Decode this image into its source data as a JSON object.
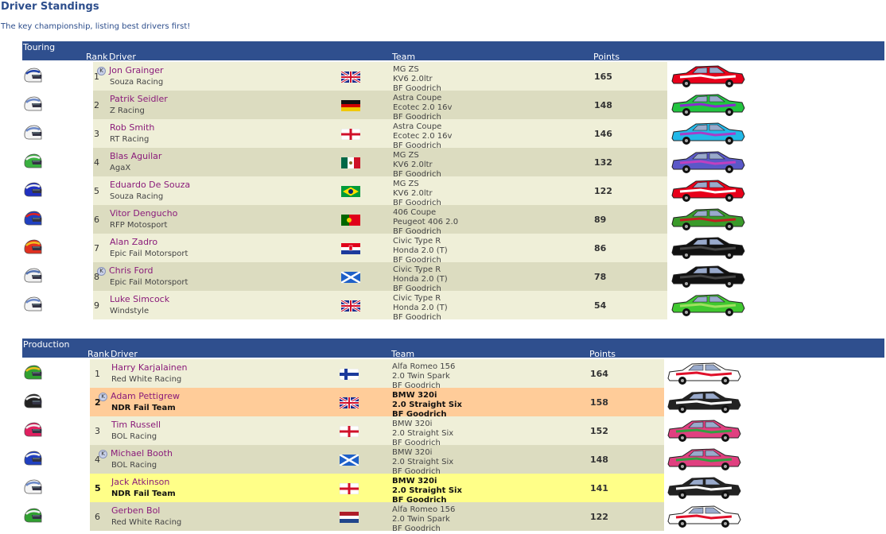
{
  "page": {
    "title": "Driver Standings",
    "subtitle": "The key championship, listing best drivers first!"
  },
  "columns": {
    "rank": "Rank",
    "driver": "Driver",
    "team": "Team",
    "points": "Points"
  },
  "colors": {
    "header": "#2f4f8e",
    "row_light": "#efefd8",
    "row_dark": "#dcdcc0",
    "row_orange": "#ffcc99",
    "row_yellow": "#ffff88",
    "driver_name": "#8a1b7a"
  },
  "sections": [
    {
      "name": "Touring",
      "rows": [
        {
          "rank": "1",
          "k": true,
          "driver": "Jon Grainger",
          "team": "Souza Racing",
          "flag": "gb",
          "car": [
            "MG ZS",
            "KV6 2.0ltr",
            "BF Goodrich"
          ],
          "points": "165",
          "helmet": [
            "#f0f0f0",
            "#1c3fa8"
          ],
          "livery": [
            "#e8001a",
            "#ffffff"
          ],
          "style": "light"
        },
        {
          "rank": "2",
          "k": false,
          "driver": "Patrik Seidler",
          "team": "Z Racing",
          "flag": "de",
          "car": [
            "Astra Coupe",
            "Ecotec 2.0 16v",
            "BF Goodrich"
          ],
          "points": "148",
          "helmet": [
            "#f4f4f4",
            "#6b88c8"
          ],
          "livery": [
            "#22c440",
            "#8a2bd0"
          ],
          "style": "dark"
        },
        {
          "rank": "3",
          "k": false,
          "driver": "Rob Smith",
          "team": "RT Racing",
          "flag": "en",
          "car": [
            "Astra Coupe",
            "Ecotec 2.0 16v",
            "BF Goodrich"
          ],
          "points": "146",
          "helmet": [
            "#f4f4f4",
            "#6b88c8"
          ],
          "livery": [
            "#22b8e8",
            "#a83cc8"
          ],
          "style": "light"
        },
        {
          "rank": "4",
          "k": false,
          "driver": "Blas Aguilar",
          "team": "AgaX",
          "flag": "mx",
          "car": [
            "MG ZS",
            "KV6 2.0ltr",
            "BF Goodrich"
          ],
          "points": "132",
          "helmet": [
            "#3ab040",
            "#f0f0f0"
          ],
          "livery": [
            "#5a58c8",
            "#c040c0"
          ],
          "style": "dark"
        },
        {
          "rank": "5",
          "k": false,
          "driver": "Eduardo De Souza",
          "team": "Souza Racing",
          "flag": "br",
          "car": [
            "MG ZS",
            "KV6 2.0ltr",
            "BF Goodrich"
          ],
          "points": "122",
          "helmet": [
            "#2030c0",
            "#f0f0f0"
          ],
          "livery": [
            "#e8001a",
            "#ffffff"
          ],
          "style": "light"
        },
        {
          "rank": "6",
          "k": false,
          "driver": "Vitor Dengucho",
          "team": "RFP Motosport",
          "flag": "pt",
          "car": [
            "406 Coupe",
            "Peugeot 406 2.0",
            "BF Goodrich"
          ],
          "points": "89",
          "helmet": [
            "#2040c0",
            "#e02020"
          ],
          "livery": [
            "#3a9a2a",
            "#c02020"
          ],
          "style": "dark"
        },
        {
          "rank": "7",
          "k": false,
          "driver": "Alan Zadro",
          "team": "Epic Fail Motorsport",
          "flag": "hr",
          "car": [
            "Civic Type R",
            "Honda 2.0 (T)",
            "BF Goodrich"
          ],
          "points": "86",
          "helmet": [
            "#e03020",
            "#f0c020"
          ],
          "livery": [
            "#111111",
            "#444444"
          ],
          "style": "light"
        },
        {
          "rank": "8",
          "k": true,
          "driver": "Chris Ford",
          "team": "Epic Fail Motorsport",
          "flag": "sc",
          "car": [
            "Civic Type R",
            "Honda 2.0 (T)",
            "BF Goodrich"
          ],
          "points": "78",
          "helmet": [
            "#f0f0f0",
            "#5070b0"
          ],
          "livery": [
            "#111111",
            "#444444"
          ],
          "style": "dark"
        },
        {
          "rank": "9",
          "k": false,
          "driver": "Luke Simcock",
          "team": "Windstyle",
          "flag": "gb",
          "car": [
            "Civic Type R",
            "Honda 2.0 (T)",
            "BF Goodrich"
          ],
          "points": "54",
          "helmet": [
            "#f4f4f4",
            "#6b88c8"
          ],
          "livery": [
            "#40c830",
            "#a0e060"
          ],
          "style": "light"
        }
      ]
    },
    {
      "name": "Production",
      "rows": [
        {
          "rank": "1",
          "k": false,
          "driver": "Harry Karjalainen",
          "team": "Red White Racing",
          "flag": "fi",
          "car": [
            "Alfa Romeo 156",
            "2.0 Twin Spark",
            "BF Goodrich"
          ],
          "points": "164",
          "helmet": [
            "#30a030",
            "#f0c020"
          ],
          "livery": [
            "#ffffff",
            "#e0102a"
          ],
          "style": "light"
        },
        {
          "rank": "2",
          "k": true,
          "driver": "Adam Pettigrew",
          "team": "NDR Fail Team",
          "flag": "gb",
          "car": [
            "BMW 320i",
            "2.0 Straight Six",
            "BF Goodrich"
          ],
          "points": "158",
          "helmet": [
            "#222222",
            "#f0f0f0"
          ],
          "livery": [
            "#222222",
            "#ffffff"
          ],
          "style": "orange"
        },
        {
          "rank": "3",
          "k": false,
          "driver": "Tim Russell",
          "team": "BOL Racing",
          "flag": "en",
          "car": [
            "BMW 320i",
            "2.0 Straight Six",
            "BF Goodrich"
          ],
          "points": "152",
          "helmet": [
            "#e02060",
            "#f0f0f0"
          ],
          "livery": [
            "#e04080",
            "#30a040"
          ],
          "style": "light"
        },
        {
          "rank": "4",
          "k": true,
          "driver": "Michael Booth",
          "team": "BOL Racing",
          "flag": "sc",
          "car": [
            "BMW 320i",
            "2.0 Straight Six",
            "BF Goodrich"
          ],
          "points": "148",
          "helmet": [
            "#2040c0",
            "#f0f0f0"
          ],
          "livery": [
            "#e04080",
            "#30a040"
          ],
          "style": "dark"
        },
        {
          "rank": "5",
          "k": false,
          "driver": "Jack Atkinson",
          "team": "NDR Fail Team",
          "flag": "en",
          "car": [
            "BMW 320i",
            "2.0 Straight Six",
            "BF Goodrich"
          ],
          "points": "141",
          "helmet": [
            "#f4f4f4",
            "#6b88c8"
          ],
          "livery": [
            "#222222",
            "#ffffff"
          ],
          "style": "yellow"
        },
        {
          "rank": "6",
          "k": false,
          "driver": "Gerben Bol",
          "team": "Red White Racing",
          "flag": "nl",
          "car": [
            "Alfa Romeo 156",
            "2.0 Twin Spark",
            "BF Goodrich"
          ],
          "points": "122",
          "helmet": [
            "#30a030",
            "#f0f0f0"
          ],
          "livery": [
            "#ffffff",
            "#e0102a"
          ],
          "style": "dark"
        }
      ]
    }
  ]
}
